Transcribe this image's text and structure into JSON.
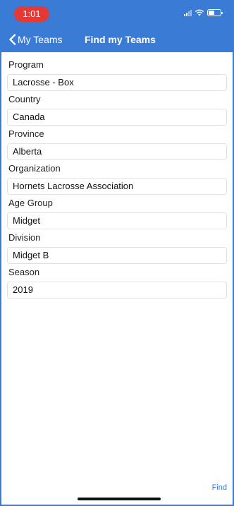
{
  "status_bar": {
    "time": "1:01",
    "icons": [
      "signal-icon",
      "wifi-icon",
      "battery-icon"
    ]
  },
  "nav": {
    "back_label": "My Teams",
    "title": "Find my Teams"
  },
  "form": {
    "fields": [
      {
        "label": "Program",
        "value": "Lacrosse - Box"
      },
      {
        "label": "Country",
        "value": "Canada"
      },
      {
        "label": "Province",
        "value": "Alberta"
      },
      {
        "label": "Organization",
        "value": "Hornets Lacrosse Association"
      },
      {
        "label": "Age Group",
        "value": "Midget"
      },
      {
        "label": "Division",
        "value": "Midget B"
      },
      {
        "label": "Season",
        "value": "2019"
      }
    ]
  },
  "footer": {
    "find_label": "Find"
  },
  "colors": {
    "accent": "#3a7bd5",
    "recording_pill": "#e53935"
  }
}
